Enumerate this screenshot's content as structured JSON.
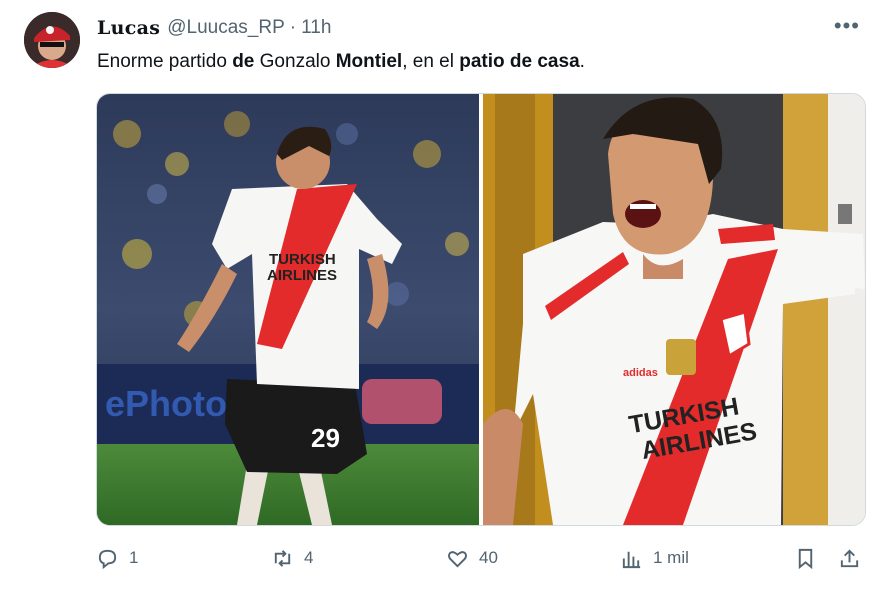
{
  "tweet": {
    "display_name": "Lucas",
    "handle": "@Luucas_RP",
    "separator": "·",
    "time": "11h",
    "text": {
      "p1": "Enorme partido ",
      "b1": "de",
      "p2": " Gonzalo ",
      "b2": "Montiel",
      "p3": ", en el ",
      "b3": "patio de casa",
      "p4": "."
    }
  },
  "photos": {
    "left": {
      "shirt_text_1": "TURKISH",
      "shirt_text_2": "AIRLINES",
      "number": "29"
    },
    "right": {
      "shirt_text_1": "TURKISH",
      "shirt_text_2": "AIRLINES"
    }
  },
  "actions": {
    "reply_count": "1",
    "retweet_count": "4",
    "like_count": "40",
    "views_count": "1 mil"
  },
  "icons": [
    "more-icon",
    "reply-icon",
    "retweet-icon",
    "like-icon",
    "views-icon",
    "bookmark-icon",
    "share-icon"
  ],
  "colors": {
    "river_red": "#e32b2b",
    "text_gray": "#536471"
  }
}
